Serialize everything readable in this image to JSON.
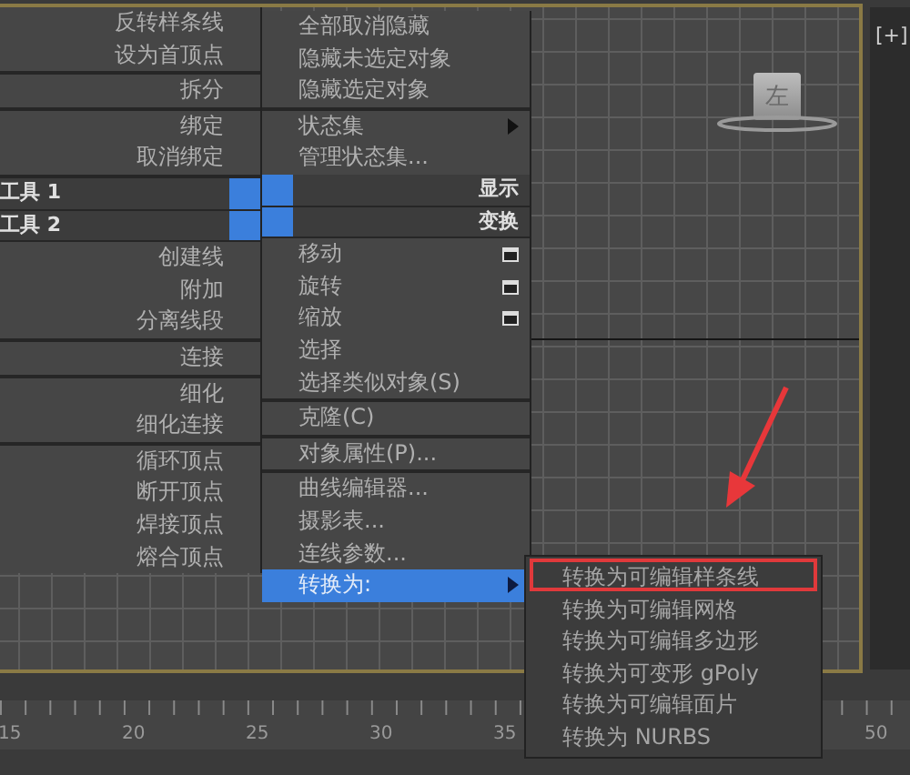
{
  "left_menu": {
    "items": [
      {
        "kind": "item",
        "label": "反转样条线"
      },
      {
        "kind": "item",
        "label": "设为首顶点"
      },
      {
        "kind": "separator"
      },
      {
        "kind": "item",
        "label": "拆分"
      },
      {
        "kind": "separator"
      },
      {
        "kind": "item",
        "label": "绑定"
      },
      {
        "kind": "item",
        "label": "取消绑定"
      },
      {
        "kind": "separator"
      },
      {
        "kind": "header",
        "label": "工具 1"
      },
      {
        "kind": "header",
        "label": "工具 2"
      },
      {
        "kind": "item",
        "label": "创建线"
      },
      {
        "kind": "item",
        "label": "附加"
      },
      {
        "kind": "item",
        "label": "分离线段"
      },
      {
        "kind": "separator"
      },
      {
        "kind": "item",
        "label": "连接"
      },
      {
        "kind": "separator"
      },
      {
        "kind": "item",
        "label": "细化"
      },
      {
        "kind": "item",
        "label": "细化连接"
      },
      {
        "kind": "separator"
      },
      {
        "kind": "item",
        "label": "循环顶点"
      },
      {
        "kind": "item",
        "label": "断开顶点"
      },
      {
        "kind": "item",
        "label": "焊接顶点"
      },
      {
        "kind": "item",
        "label": "熔合顶点"
      }
    ]
  },
  "right_menu": {
    "items": [
      {
        "kind": "item",
        "label": "全部取消隐藏",
        "selected": false,
        "options": false,
        "submenu": false
      },
      {
        "kind": "item",
        "label": "隐藏未选定对象",
        "selected": false,
        "options": false,
        "submenu": false
      },
      {
        "kind": "item",
        "label": "隐藏选定对象",
        "selected": false,
        "options": false,
        "submenu": false
      },
      {
        "kind": "separator"
      },
      {
        "kind": "item",
        "label": "状态集",
        "selected": false,
        "options": false,
        "submenu": true
      },
      {
        "kind": "item",
        "label": "管理状态集...",
        "selected": false,
        "options": false,
        "submenu": false
      },
      {
        "kind": "header",
        "label": "显示"
      },
      {
        "kind": "header",
        "label": "变换"
      },
      {
        "kind": "item",
        "label": "移动",
        "selected": false,
        "options": true,
        "submenu": false
      },
      {
        "kind": "item",
        "label": "旋转",
        "selected": false,
        "options": true,
        "submenu": false
      },
      {
        "kind": "item",
        "label": "缩放",
        "selected": false,
        "options": true,
        "submenu": false
      },
      {
        "kind": "item",
        "label": "选择",
        "selected": false,
        "options": false,
        "submenu": false
      },
      {
        "kind": "item",
        "label": "选择类似对象(S)",
        "selected": false,
        "options": false,
        "submenu": false
      },
      {
        "kind": "separator"
      },
      {
        "kind": "item",
        "label": "克隆(C)",
        "selected": false,
        "options": false,
        "submenu": false
      },
      {
        "kind": "separator"
      },
      {
        "kind": "item",
        "label": "对象属性(P)...",
        "selected": false,
        "options": false,
        "submenu": false
      },
      {
        "kind": "separator"
      },
      {
        "kind": "item",
        "label": "曲线编辑器...",
        "selected": false,
        "options": false,
        "submenu": false
      },
      {
        "kind": "item",
        "label": "摄影表...",
        "selected": false,
        "options": false,
        "submenu": false
      },
      {
        "kind": "item",
        "label": "连线参数...",
        "selected": false,
        "options": false,
        "submenu": false
      },
      {
        "kind": "item",
        "label": "转换为:",
        "selected": true,
        "options": false,
        "submenu": true
      }
    ]
  },
  "submenu": {
    "items": [
      {
        "label": "转换为可编辑样条线",
        "marked": true
      },
      {
        "label": "转换为可编辑网格",
        "marked": false
      },
      {
        "label": "转换为可编辑多边形",
        "marked": false
      },
      {
        "label": "转换为可变形 gPoly",
        "marked": false
      },
      {
        "label": "转换为可编辑面片",
        "marked": false
      },
      {
        "label": "转换为 NURBS",
        "marked": false
      }
    ]
  },
  "viewport": {
    "viewcube_label": "左",
    "corner_label": "[+]"
  },
  "timeline": {
    "ticks": [
      "15",
      "20",
      "25",
      "30",
      "35",
      "50"
    ]
  }
}
